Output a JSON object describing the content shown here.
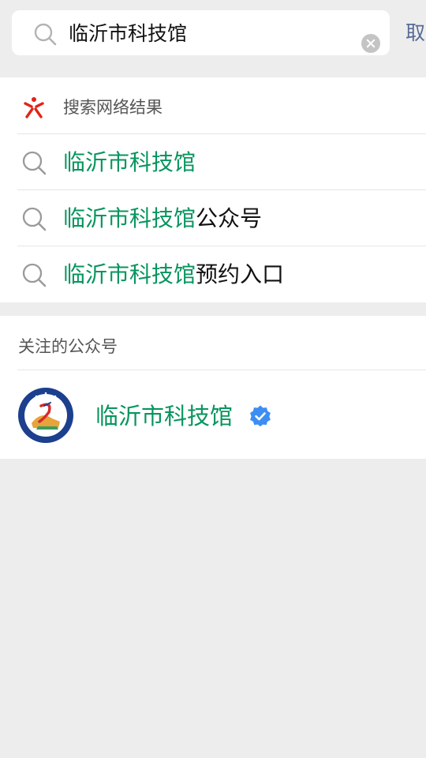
{
  "search": {
    "query": "临沂市科技馆",
    "cancel_label": "取消"
  },
  "web_results": {
    "header": "搜索网络结果",
    "suggestions": [
      {
        "highlight": "临沂市科技馆",
        "rest": ""
      },
      {
        "highlight": "临沂市科技馆",
        "rest": "公众号"
      },
      {
        "highlight": "临沂市科技馆",
        "rest": "预约入口"
      }
    ]
  },
  "followed": {
    "header": "关注的公众号",
    "accounts": [
      {
        "name": "临沂市科技馆",
        "verified": true
      }
    ]
  },
  "colors": {
    "highlight": "#07955e",
    "link": "#576b95",
    "verified": "#3d8ef2",
    "sou_logo": "#e2231a"
  },
  "icons": {
    "search": "search-icon",
    "clear": "clear-icon",
    "web_search": "sou-logo-icon",
    "verified": "verified-badge-icon"
  }
}
